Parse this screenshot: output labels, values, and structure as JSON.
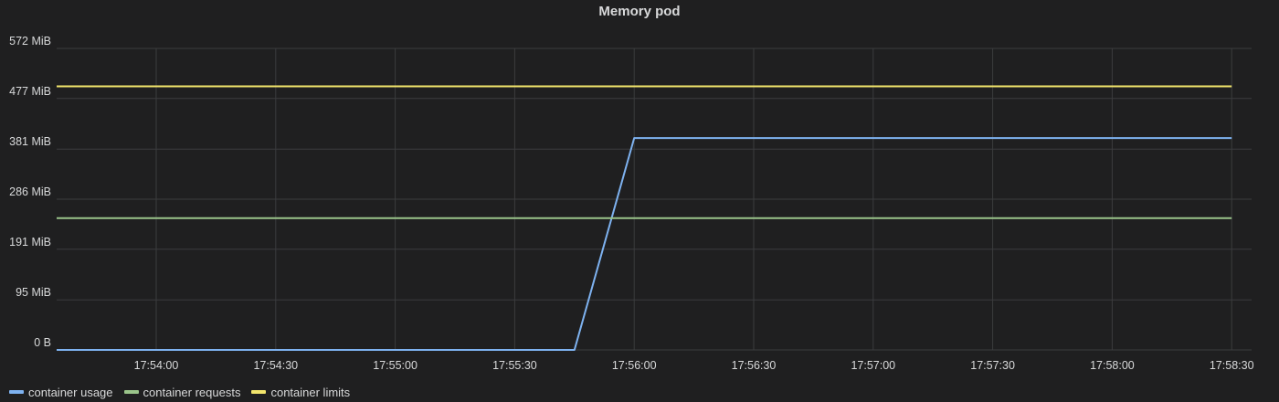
{
  "panel": {
    "title": "Memory pod"
  },
  "colors": {
    "background": "#1f1f20",
    "grid": "#3b3c3e",
    "text": "#d8d9da"
  },
  "chart_data": {
    "type": "line",
    "title": "Memory pod",
    "xlabel": "",
    "ylabel": "",
    "x_range": [
      "17:53:35",
      "17:58:35"
    ],
    "x_ticks": [
      "17:54:00",
      "17:54:30",
      "17:55:00",
      "17:55:30",
      "17:56:00",
      "17:56:30",
      "17:57:00",
      "17:57:30",
      "17:58:00",
      "17:58:30"
    ],
    "y_unit": "MiB",
    "ylim": [
      0,
      572
    ],
    "y_ticks": [
      {
        "value": 0,
        "label": "0 B"
      },
      {
        "value": 95,
        "label": "95 MiB"
      },
      {
        "value": 191,
        "label": "191 MiB"
      },
      {
        "value": 286,
        "label": "286 MiB"
      },
      {
        "value": 381,
        "label": "381 MiB"
      },
      {
        "value": 477,
        "label": "477 MiB"
      },
      {
        "value": 572,
        "label": "572 MiB"
      }
    ],
    "grid": true,
    "legend_position": "bottom-left",
    "series": [
      {
        "name": "container usage",
        "color": "#7eb2f0",
        "points": [
          [
            "17:53:35",
            0
          ],
          [
            "17:55:45",
            0
          ],
          [
            "17:56:00",
            402
          ],
          [
            "17:58:30",
            402
          ]
        ]
      },
      {
        "name": "container requests",
        "color": "#9ac48a",
        "points": [
          [
            "17:53:35",
            250
          ],
          [
            "17:58:30",
            250
          ]
        ]
      },
      {
        "name": "container limits",
        "color": "#f2e56c",
        "points": [
          [
            "17:53:35",
            500
          ],
          [
            "17:58:30",
            500
          ]
        ]
      }
    ]
  }
}
